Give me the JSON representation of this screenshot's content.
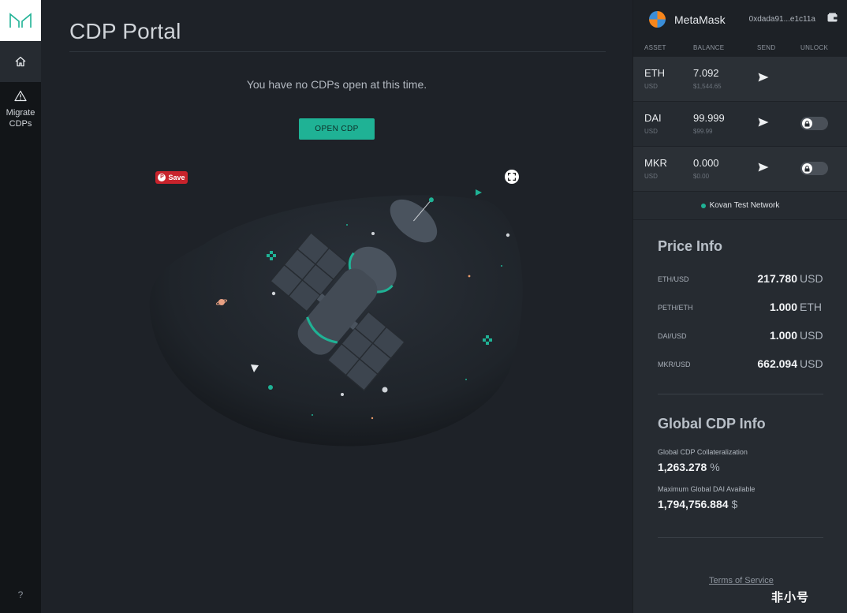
{
  "rail": {
    "home_icon": "home-icon",
    "migrate_icon": "warning-icon",
    "migrate_label_1": "Migrate",
    "migrate_label_2": "CDPs",
    "help_label": "?"
  },
  "main": {
    "title": "CDP Portal",
    "empty_message": "You have no CDPs open at this time.",
    "open_cdp_label": "OPEN CDP",
    "pin_save_label": "Save"
  },
  "metamask": {
    "name": "MetaMask",
    "address": "0xdada91...e1c11a",
    "columns": {
      "asset": "ASSET",
      "balance": "BALANCE",
      "send": "SEND",
      "unlock": "UNLOCK"
    },
    "assets": [
      {
        "symbol": "ETH",
        "sub": "USD",
        "balance": "7.092",
        "usd": "$1,544.65",
        "unlock": false
      },
      {
        "symbol": "DAI",
        "sub": "USD",
        "balance": "99.999",
        "usd": "$99.99",
        "unlock": true
      },
      {
        "symbol": "MKR",
        "sub": "USD",
        "balance": "0.000",
        "usd": "$0.00",
        "unlock": true
      }
    ],
    "network": "Kovan Test Network",
    "network_color": "#1fb295"
  },
  "price_info": {
    "title": "Price Info",
    "rows": [
      {
        "pair": "ETH/USD",
        "value": "217.780",
        "unit": "USD"
      },
      {
        "pair": "PETH/ETH",
        "value": "1.000",
        "unit": "ETH"
      },
      {
        "pair": "DAI/USD",
        "value": "1.000",
        "unit": "USD"
      },
      {
        "pair": "MKR/USD",
        "value": "662.094",
        "unit": "USD"
      }
    ]
  },
  "global_cdp": {
    "title": "Global CDP Info",
    "collateralization_label": "Global CDP Collateralization",
    "collateralization_value": "1,263.278",
    "collateralization_unit": "%",
    "max_dai_label": "Maximum Global DAI Available",
    "max_dai_value": "1,794,756.884",
    "max_dai_unit": "$"
  },
  "footer": {
    "terms": "Terms of Service",
    "watermark": "非小号"
  },
  "colors": {
    "accent": "#1fb295",
    "background": "#1e2228",
    "panel": "#262b31",
    "rail": "#121518"
  }
}
